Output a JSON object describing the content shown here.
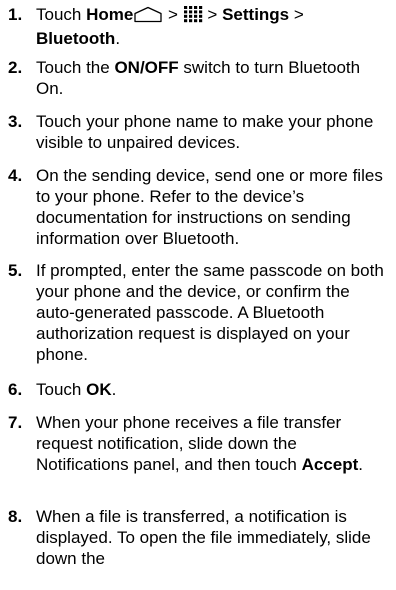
{
  "steps": [
    {
      "num": "1.",
      "parts": [
        {
          "t": "Touch "
        },
        {
          "b": "Home"
        },
        {
          "icon": "home-icon"
        },
        {
          "t": " > "
        },
        {
          "icon": "apps-grid-icon"
        },
        {
          "t": " > "
        },
        {
          "b": "Settings"
        },
        {
          "t": " > "
        },
        {
          "b": "Bluetooth"
        },
        {
          "t": "."
        }
      ]
    },
    {
      "num": "2.",
      "parts": [
        {
          "t": "Touch the "
        },
        {
          "b": "ON/OFF"
        },
        {
          "t": " switch to turn Bluetooth On."
        }
      ]
    },
    {
      "num": "3.",
      "parts": [
        {
          "t": "Touch your phone name to make your phone visible to unpaired devices."
        }
      ]
    },
    {
      "num": "4.",
      "parts": [
        {
          "t": "On the sending device, send one or more files to your phone. Refer to the device’s documentation for instructions on sending information over Bluetooth."
        }
      ]
    },
    {
      "num": "5.",
      "parts": [
        {
          "t": "If prompted, enter the same passcode on both your phone and the device, or confirm the auto-generated passcode. A Bluetooth authorization request is displayed on your phone."
        }
      ]
    },
    {
      "num": "6.",
      "parts": [
        {
          "t": "Touch "
        },
        {
          "b": "OK"
        },
        {
          "t": "."
        }
      ]
    },
    {
      "num": "7.",
      "parts": [
        {
          "t": "When your phone receives a file transfer request notification, slide down the Notifications panel, and then touch "
        },
        {
          "b": "Accept"
        },
        {
          "t": "."
        }
      ]
    },
    {
      "num": "8.",
      "parts": [
        {
          "t": "When a file is transferred, a notification is displayed. To open the file immediately, slide down the"
        }
      ]
    }
  ]
}
